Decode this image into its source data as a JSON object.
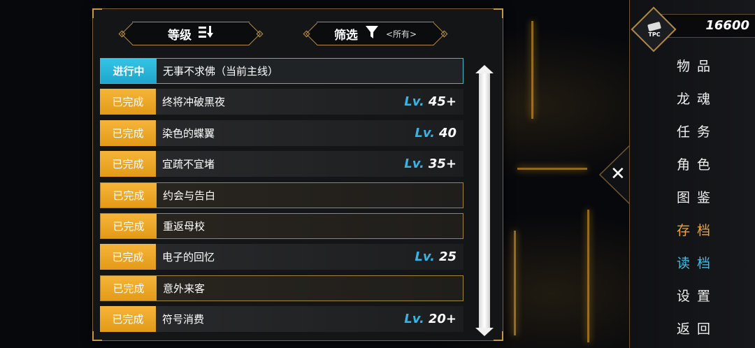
{
  "header": {
    "level_label": "等级",
    "level_icon": "sort-desc-icon",
    "filter_label": "筛选",
    "filter_icon": "funnel-icon",
    "filter_value": "<所有>"
  },
  "quests": [
    {
      "status": "进行中",
      "name": "无事不求佛（当前主线）",
      "level": "",
      "state": "active"
    },
    {
      "status": "已完成",
      "name": "终将冲破黑夜",
      "level": "45+",
      "state": "done"
    },
    {
      "status": "已完成",
      "name": "染色的蝶翼",
      "level": "40",
      "state": "done"
    },
    {
      "status": "已完成",
      "name": "宜疏不宜堵",
      "level": "35+",
      "state": "done"
    },
    {
      "status": "已完成",
      "name": "约会与告白",
      "level": "",
      "state": "outlined"
    },
    {
      "status": "已完成",
      "name": "重返母校",
      "level": "",
      "state": "outlined"
    },
    {
      "status": "已完成",
      "name": "电子的回忆",
      "level": "25",
      "state": "done"
    },
    {
      "status": "已完成",
      "name": "意外来客",
      "level": "",
      "state": "outlined"
    },
    {
      "status": "已完成",
      "name": "符号消费",
      "level": "20+",
      "state": "done"
    }
  ],
  "lv_prefix": "Lv.",
  "currency": {
    "icon_text": "TPC",
    "value": "16600"
  },
  "close_icon": "close-icon",
  "menu": [
    {
      "label": "物品",
      "color": "#f0f0f0"
    },
    {
      "label": "龙魂",
      "color": "#f0f0f0"
    },
    {
      "label": "任务",
      "color": "#f0f0f0"
    },
    {
      "label": "角色",
      "color": "#f0f0f0"
    },
    {
      "label": "图鉴",
      "color": "#f0f0f0"
    },
    {
      "label": "存档",
      "color": "#f0a42a"
    },
    {
      "label": "读档",
      "color": "#3cc0ea"
    },
    {
      "label": "设置",
      "color": "#f0f0f0"
    },
    {
      "label": "返回",
      "color": "#f0f0f0"
    }
  ],
  "colors": {
    "gold": "#c9973c",
    "done_badge": "#eda72a",
    "active_badge": "#2ab6dc",
    "lv_blue": "#36b4e6"
  }
}
